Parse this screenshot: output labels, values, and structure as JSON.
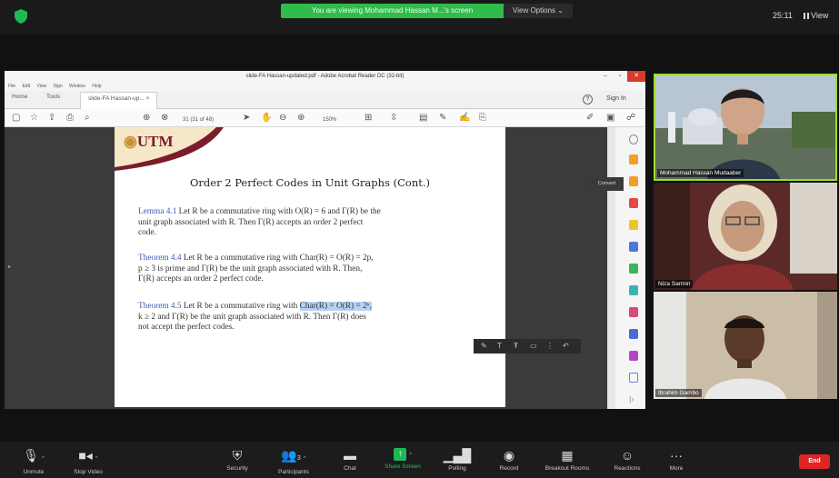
{
  "zoom": {
    "banner_text": "You are viewing Mohammad Hassan M...'s screen",
    "view_options": "View Options ⌄",
    "timer": "25:11",
    "view_label": "View"
  },
  "acrobat": {
    "window_title": "slide-FA Hassan-updated.pdf - Adobe Acrobat Reader DC (32-bit)",
    "menu": [
      "File",
      "Edit",
      "View",
      "Sign",
      "Window",
      "Help"
    ],
    "tabs": {
      "home": "Home",
      "tools": "Tools",
      "doc": "slide-FA Hassan-up... ×"
    },
    "help": "?",
    "sign_in": "Sign In",
    "page_indicator": "31 (31 of 48)",
    "zoom_level": "150%",
    "convert_tooltip": "Convert"
  },
  "slide": {
    "logo_text": "UTM",
    "title": "Order 2 Perfect Codes in Unit Graphs (Cont.)",
    "lemma": {
      "label": "Lemma 4.1",
      "line1": " Let R be a commutative ring with O(R) = 6 and Γ(R) be the",
      "line2": "unit graph associated with R. Then Γ(R) accepts an order 2 perfect",
      "line3": "code."
    },
    "theorem44": {
      "label": "Theorem 4.4",
      "line1": " Let R be a commutative ring with Char(R) = O(R) = 2p,",
      "line2": "p ≥ 3 is prime and Γ(R) be the unit graph associated with R. Then,",
      "line3": "Γ(R) accepts an order 2 perfect code."
    },
    "theorem45": {
      "label": "Theorem 4.5",
      "line1a": " Let R be a commutative ring with ",
      "line1_highlight": "Char(R) = O(R) = 2ᵏ,",
      "line2": "k ≥ 2 and Γ(R) be the unit graph associated with R. Then Γ(R) does",
      "line3": "not accept the perfect codes."
    }
  },
  "participants": [
    {
      "name": "Mohammad Hassan Mudaaber"
    },
    {
      "name": "Niza Sarmin"
    },
    {
      "name": "Ibrahim Gambo"
    }
  ],
  "controls": {
    "unmute": "Unmute",
    "stop_video": "Stop Video",
    "security": "Security",
    "participants": "Participants",
    "participants_count": "3",
    "chat": "Chat",
    "share_screen": "Share Screen",
    "polling": "Polling",
    "record": "Record",
    "breakout": "Breakout Rooms",
    "reactions": "Reactions",
    "more": "More",
    "end": "End"
  },
  "colors": {
    "banner_green": "#2fbc4b",
    "active_speaker_border": "#9edb2f",
    "end_red": "#e02424",
    "theorem_label_blue": "#3a5bb5",
    "utm_maroon": "#7b1c2a"
  }
}
